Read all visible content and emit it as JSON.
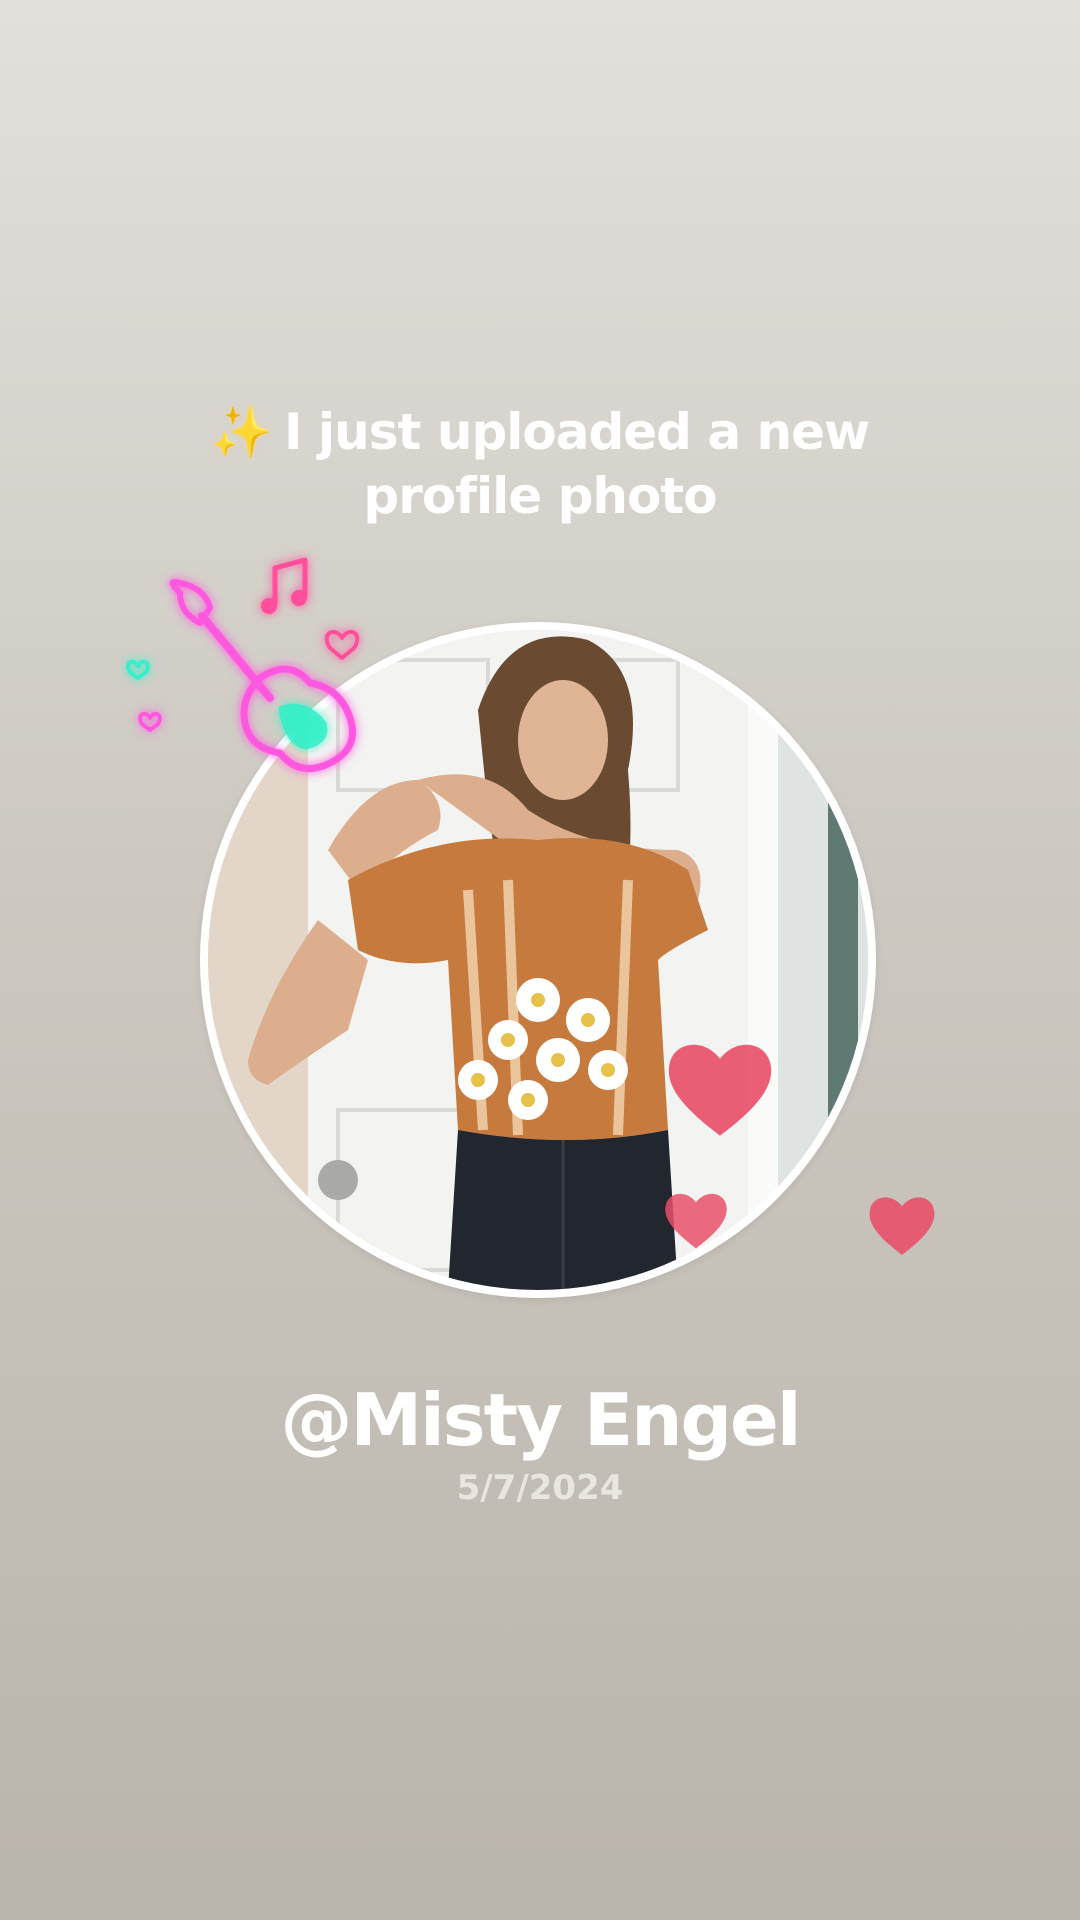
{
  "headline": {
    "sparkle": "✨",
    "text": "I just uploaded a new profile photo"
  },
  "profile": {
    "username": "@Misty Engel",
    "date": "5/7/2024"
  },
  "decorations": {
    "sticker_icon": "neon-guitar-icon",
    "heart_icon": "heart-icon",
    "heart_color": "#e8506a",
    "neon_pink": "#ff4fd8",
    "neon_cyan": "#36f0c8"
  }
}
